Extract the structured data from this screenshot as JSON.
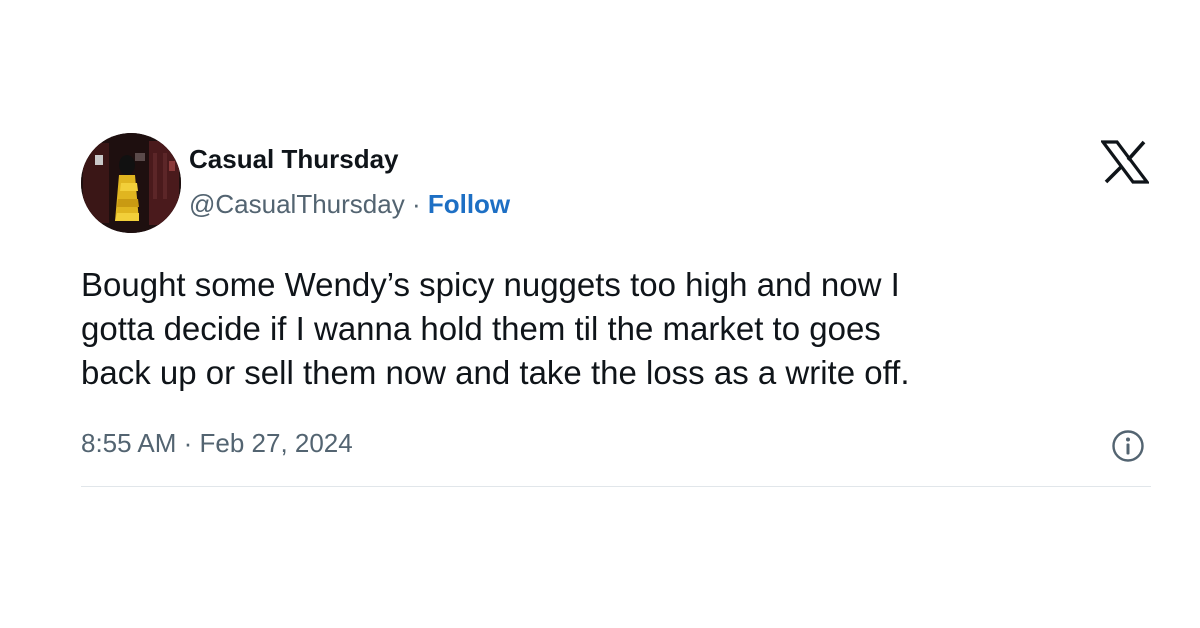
{
  "tweet": {
    "display_name": "Casual Thursday",
    "handle": "@CasualThursday",
    "separator": " · ",
    "follow_label": "Follow",
    "text": "Bought some Wendy’s spicy nuggets too high and now I\ngotta decide if I wanna hold them til the market to goes\nback up or sell them now and take the loss as a write off.",
    "timestamp": "8:55 AM · Feb 27, 2024"
  },
  "icons": {
    "brand": "x-logo-icon",
    "info": "info-icon"
  },
  "colors": {
    "follow_link": "#1d6fc4",
    "secondary_text": "#536471",
    "primary_text": "#0f1419",
    "divider": "#e1e6ea"
  }
}
